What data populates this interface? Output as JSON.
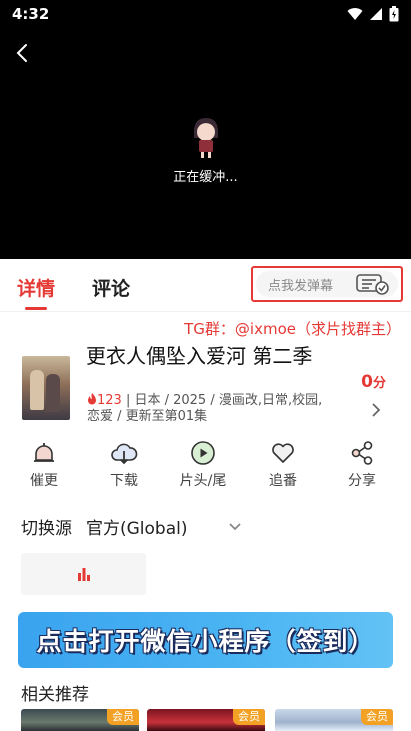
{
  "status_bar": {
    "time": "4:32"
  },
  "player": {
    "loading_text": "正在缓冲..."
  },
  "tabs": {
    "details": "详情",
    "comments": "评论"
  },
  "danmaku": {
    "placeholder": "点我发弹幕"
  },
  "tg_notice": "TG群：@ixmoe（求片找群主）",
  "anime": {
    "title": "更衣人偶坠入爱河 第二季",
    "hot_count": "123",
    "meta_rest": " | 日本 / 2025 / 漫画改,日常,校园,恋爱 / 更新至第01集",
    "score_value": "0",
    "score_unit": "分"
  },
  "actions": [
    {
      "label": "催更",
      "icon": "bell-icon"
    },
    {
      "label": "下载",
      "icon": "cloud-download-icon"
    },
    {
      "label": "片头/尾",
      "icon": "play-circle-icon"
    },
    {
      "label": "追番",
      "icon": "heart-icon"
    },
    {
      "label": "分享",
      "icon": "share-icon"
    }
  ],
  "source": {
    "label": "切换源",
    "value": "官方(Global)"
  },
  "banner": {
    "text": "点击打开微信小程序（签到）"
  },
  "related": {
    "title": "相关推荐",
    "items": [
      {
        "badge": "会员"
      },
      {
        "badge": "会员"
      },
      {
        "badge": "会员"
      }
    ]
  },
  "colors": {
    "accent": "#e53935",
    "badge": "#f2a124",
    "banner": "#3aa3ef"
  }
}
